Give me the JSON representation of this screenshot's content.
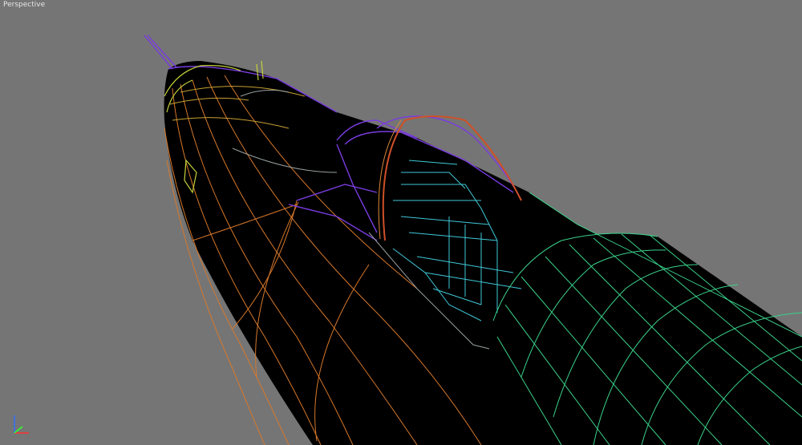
{
  "viewport": {
    "label": "Perspective",
    "background": "#757575"
  },
  "model": {
    "fill_color": "#000000",
    "edge_colors": {
      "fuselage": "#d8782a",
      "canopy": "#7a3ce0",
      "cockpit": "#3fc8d8",
      "wing_root": "#3ad28a",
      "nose_trim": "#c4d23a"
    }
  },
  "axis_gizmo": {
    "icon": "xyz-axis-icon",
    "colors": {
      "x": "#ff3030",
      "y": "#30ff30",
      "z": "#3070ff"
    }
  }
}
